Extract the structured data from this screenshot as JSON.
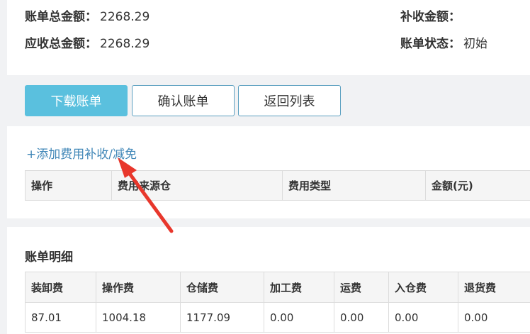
{
  "summary": {
    "bill_total_label": "账单总金额：",
    "bill_total_value": "2268.29",
    "receivable_label": "应收总金额：",
    "receivable_value": "2268.29",
    "supplement_label": "补收金额：",
    "supplement_value": "",
    "status_label": "账单状态：",
    "status_value": "初始"
  },
  "actions": {
    "download": "下载账单",
    "confirm": "确认账单",
    "back": "返回列表"
  },
  "fees": {
    "add_link": "+添加费用补收/减免",
    "columns": [
      "操作",
      "费用来源仓",
      "费用类型",
      "金额(元)"
    ]
  },
  "detail": {
    "title": "账单明细",
    "columns": [
      "装卸费",
      "操作费",
      "仓储费",
      "加工费",
      "运费",
      "入仓费",
      "退货费"
    ],
    "rows": [
      [
        "87.01",
        "1004.18",
        "1177.09",
        "0.00",
        "0.00",
        "0.00",
        "0.00"
      ]
    ]
  },
  "colors": {
    "primary": "#5ac0de",
    "link": "#3f86b7",
    "arrow": "#e8372c"
  },
  "annotation": {
    "type": "arrow-pointing-to-add-link"
  }
}
